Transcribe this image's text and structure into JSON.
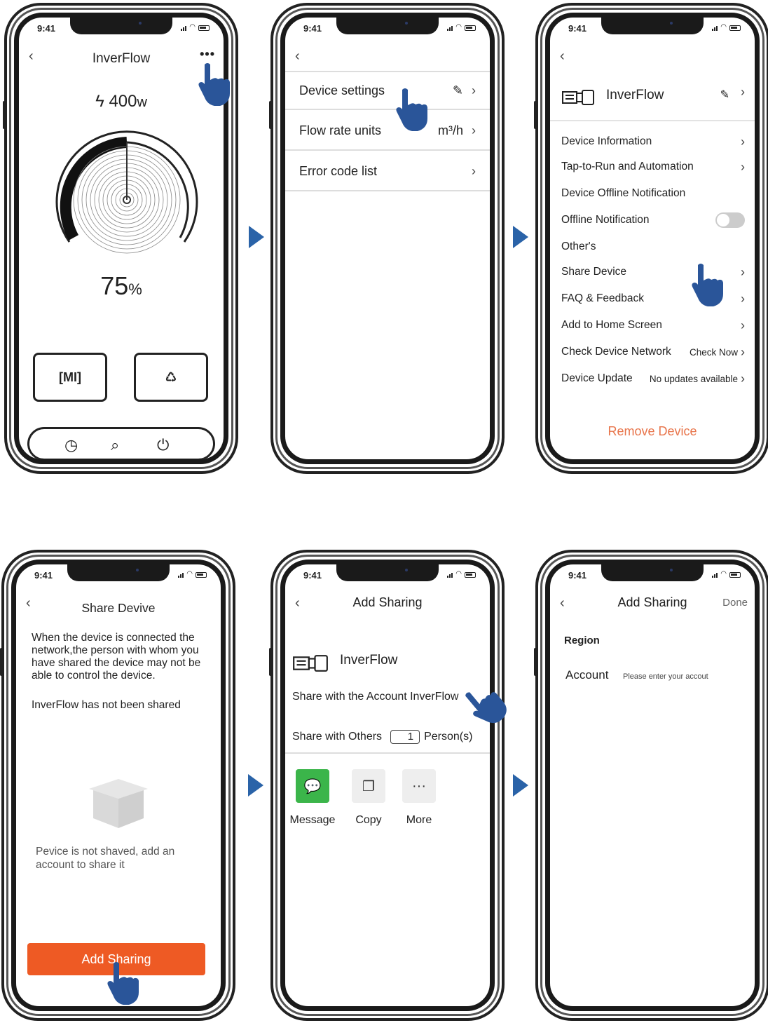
{
  "status_time": "9:41",
  "screen1": {
    "title": "InverFlow",
    "power_value": "400",
    "power_unit": "w",
    "percent_value": "75",
    "percent_unit": "%",
    "mode_button_label": "[MI]",
    "recycle_icon": "recycle-icon",
    "bottom_icons": [
      "clock-icon",
      "search-icon",
      "power-icon"
    ],
    "gauge_level": 0.75
  },
  "screen2": {
    "rows": [
      {
        "label": "Device settings",
        "value": ""
      },
      {
        "label": "Flow rate units",
        "value": "m³/h"
      },
      {
        "label": "Error code list",
        "value": ""
      }
    ]
  },
  "screen3": {
    "device_name": "InverFlow",
    "rows": [
      {
        "label": "Device Information",
        "value": ""
      },
      {
        "label": "Tap-to-Run and Automation",
        "value": ""
      },
      {
        "label": "Device Offline Notification",
        "value": ""
      },
      {
        "label": "Offline Notification",
        "value": ""
      },
      {
        "label": "Other's",
        "value": ""
      },
      {
        "label": "Share Device",
        "value": ""
      },
      {
        "label": "FAQ & Feedback",
        "value": ""
      },
      {
        "label": "Add to Home Screen",
        "value": ""
      },
      {
        "label": "Check Device Network",
        "value": "Check Now"
      },
      {
        "label": "Device Update",
        "value": "No updates available"
      }
    ],
    "offline_notification_on": false,
    "remove_label": "Remove Device",
    "accent_color": "#e8744a"
  },
  "screen4": {
    "title": "Share Devive",
    "warning": "When the device is connected the network,the person with whom you have shared the device may not be able to control the device.",
    "not_shared": "InverFlow has not been shared",
    "empty_text": "Pevice is  not  shaved, add an account to share it",
    "button_label": "Add Sharing",
    "button_color": "#ee5a24"
  },
  "screen5": {
    "title": "Add Sharing",
    "device_name": "InverFlow",
    "share_account": "Share with the Account InverFlow",
    "share_others": "Share with Others",
    "persons_value": "1",
    "persons_label": "Person(s)",
    "apps": [
      {
        "label": "Message",
        "icon": "wechat-icon"
      },
      {
        "label": "Copy",
        "icon": "copy-icon"
      },
      {
        "label": "More",
        "icon": "more-icon"
      }
    ]
  },
  "screen6": {
    "title": "Add Sharing",
    "done": "Done",
    "region": "Region",
    "account": "Account",
    "account_placeholder": "Please enter your accout"
  },
  "arrow_color": "#2a63a8",
  "hand_color": "#2a5599"
}
